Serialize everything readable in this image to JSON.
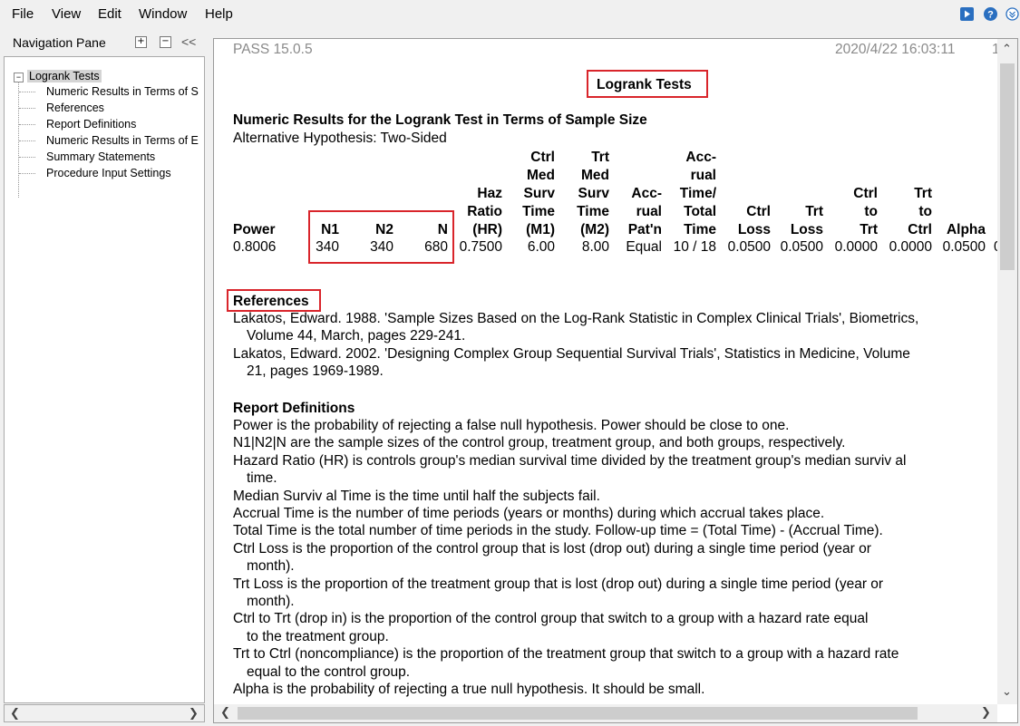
{
  "menu": {
    "file": "File",
    "view": "View",
    "edit": "Edit",
    "window": "Window",
    "help": "Help"
  },
  "toolbar_icons": [
    "play-icon",
    "help-icon",
    "collapse-icon"
  ],
  "nav": {
    "title": "Navigation Pane",
    "collapse_label": "<<",
    "tree": {
      "root": "Logrank Tests",
      "children": [
        "Numeric Results in Terms of S",
        "References",
        "Report Definitions",
        "Numeric Results in Terms of E",
        "Summary Statements",
        "Procedure Input Settings"
      ]
    }
  },
  "report": {
    "app_version": "PASS 15.0.5",
    "datetime": "2020/4/22 16:03:11",
    "page_num": "1",
    "main_title": "Logrank Tests",
    "section_title": "Numeric Results for the Logrank Test in Terms of Sample Size",
    "alt_hypothesis": "Alternative Hypothesis: Two-Sided",
    "table": {
      "headers": [
        [
          "Power"
        ],
        [
          "N1"
        ],
        [
          "N2"
        ],
        [
          "N"
        ],
        [
          "Haz",
          "Ratio",
          "(HR)"
        ],
        [
          "Ctrl",
          "Med",
          "Surv",
          "Time",
          "(M1)"
        ],
        [
          "Trt",
          "Med",
          "Surv",
          "Time",
          "(M2)"
        ],
        [
          "Acc-",
          "rual",
          "Pat'n"
        ],
        [
          "Acc-",
          "rual",
          "Time/",
          "Total",
          "Time"
        ],
        [
          "Ctrl",
          "Loss"
        ],
        [
          "Trt",
          "Loss"
        ],
        [
          "Ctrl",
          "to",
          "Trt"
        ],
        [
          "Trt",
          "to",
          "Ctrl"
        ],
        [
          "Alpha"
        ]
      ],
      "row": [
        "0.8006",
        "340",
        "340",
        "680",
        "0.7500",
        "6.00",
        "8.00",
        "Equal",
        "10 / 18",
        "0.0500",
        "0.0500",
        "0.0000",
        "0.0000",
        "0.0500",
        "0"
      ]
    },
    "references_title": "References",
    "references": [
      [
        "Lakatos, Edward. 1988. 'Sample Sizes Based on the Log-Rank Statistic in Complex Clinical Trials', Biometrics,",
        "Volume 44, March, pages 229-241."
      ],
      [
        "Lakatos, Edward. 2002. 'Designing Complex Group Sequential Survival Trials', Statistics in Medicine, Volume",
        "21, pages 1969-1989."
      ]
    ],
    "definitions_title": "Report Definitions",
    "definitions": [
      [
        "Power is the probability of rejecting a false null hypothesis. Power should be close to one."
      ],
      [
        "N1|N2|N are the sample sizes of the control group, treatment group, and both groups, respectively."
      ],
      [
        "Hazard Ratio (HR) is controls group's median survival time divided by the treatment group's median surviv al",
        "time."
      ],
      [
        "Median Surviv al Time is the time until half the subjects fail."
      ],
      [
        "Accrual Time is the number of time periods (years or months) during which accrual takes place."
      ],
      [
        "Total Time is the total number of time periods in the study. Follow-up time = (Total Time) - (Accrual Time)."
      ],
      [
        "Ctrl Loss is the proportion of the control group that is lost (drop out) during a single time period (year or",
        "month)."
      ],
      [
        "Trt Loss is the proportion of the treatment group that is lost (drop out) during a single time period (year or",
        "month)."
      ],
      [
        "Ctrl to Trt (drop in) is the proportion of the control group that switch to a group with a hazard rate equal",
        "to the treatment group."
      ],
      [
        "Trt to Ctrl (noncompliance) is the proportion of the treatment group that switch to a group with a hazard rate",
        "equal to the control group."
      ],
      [
        "Alpha is the probability of rejecting a true null hypothesis. It should be small."
      ]
    ]
  }
}
